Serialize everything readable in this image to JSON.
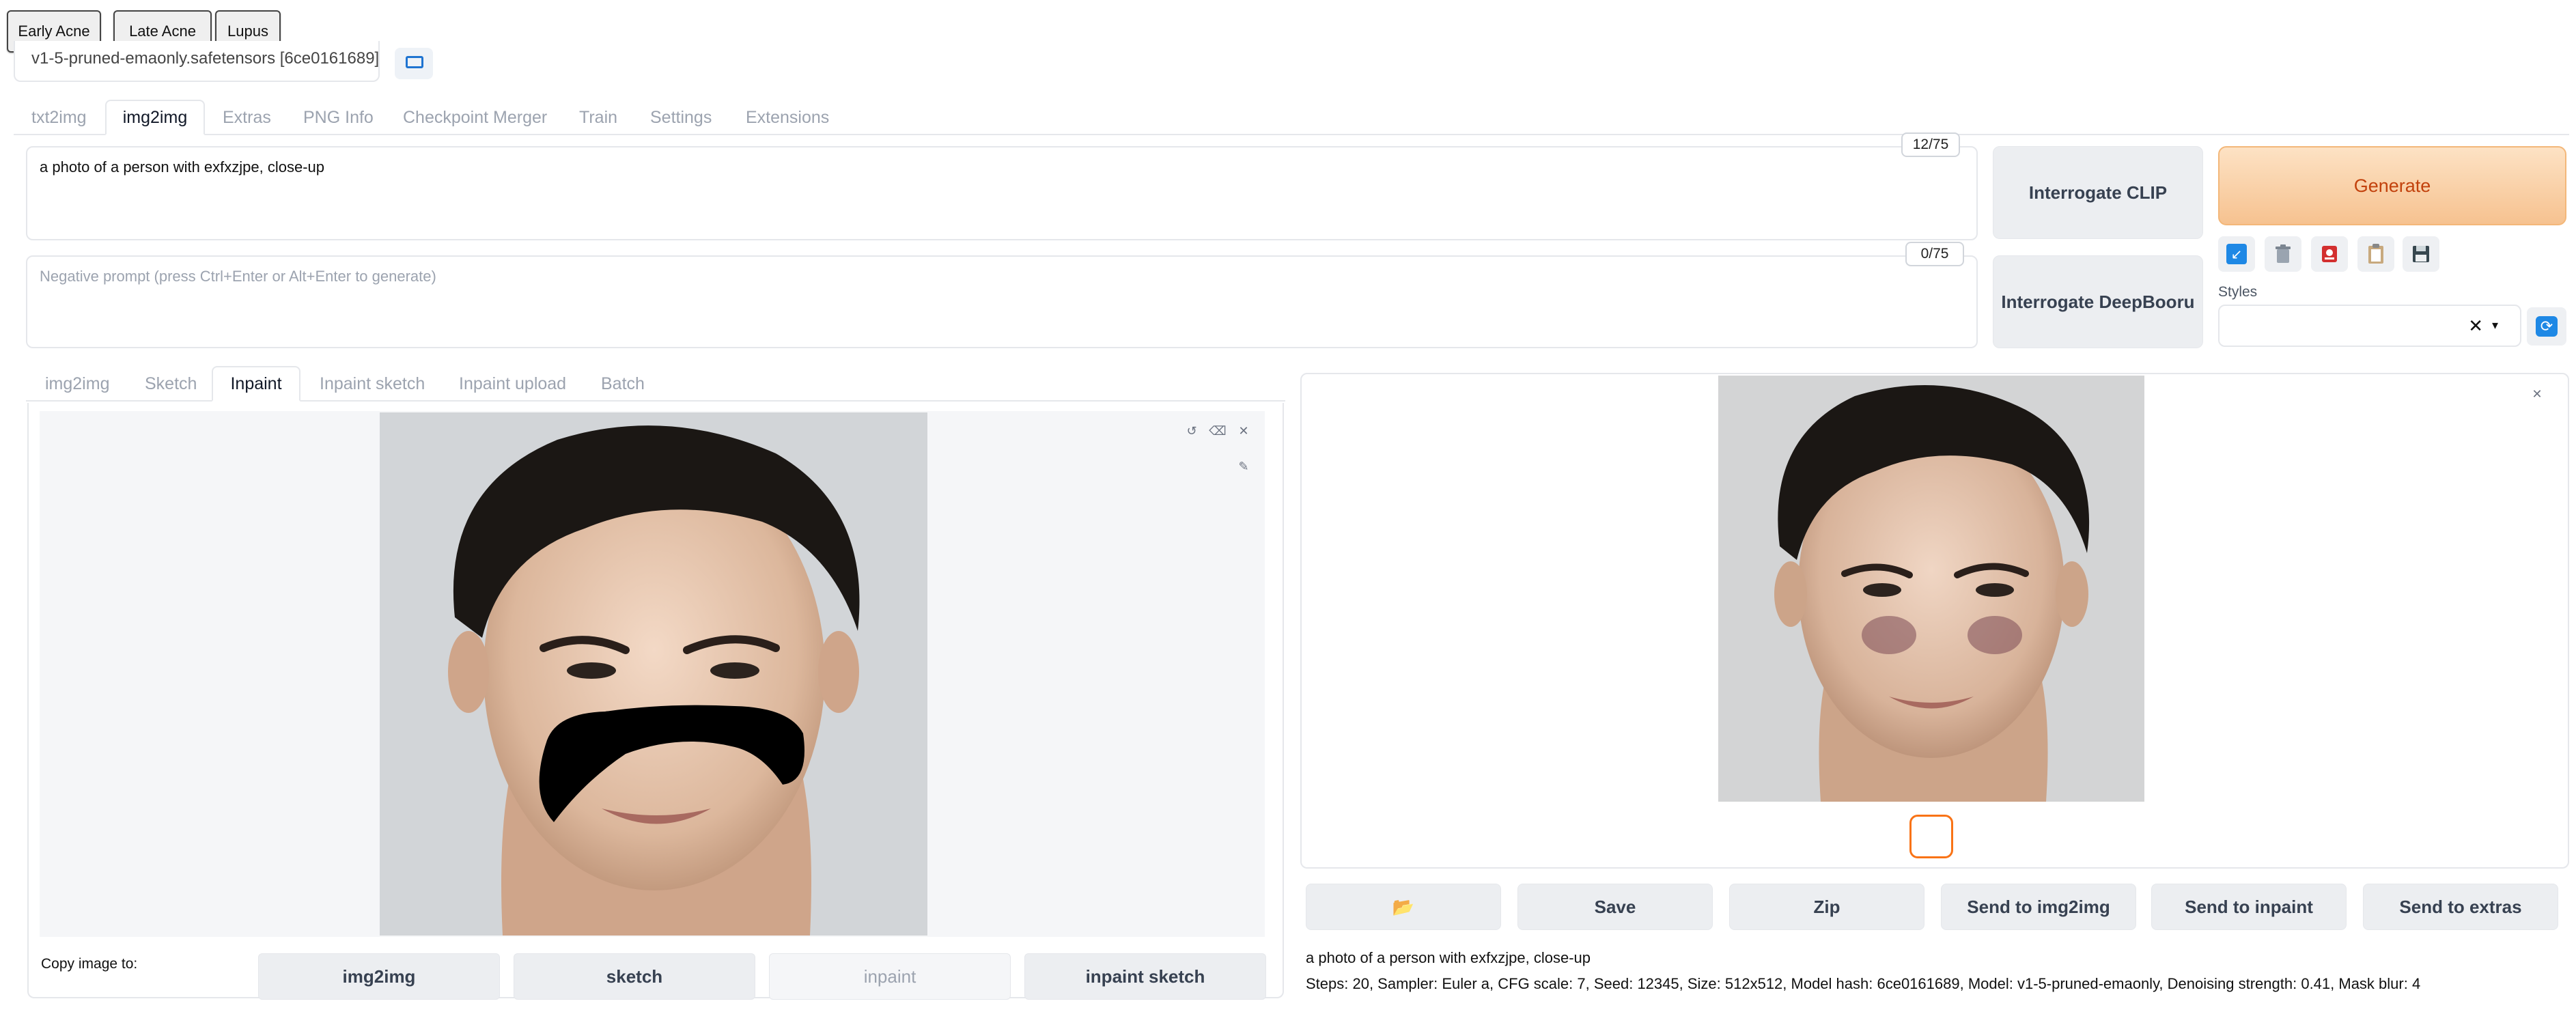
{
  "presets": [
    "Early Acne",
    "Late Acne",
    "Lupus"
  ],
  "checkpoint": {
    "value": "v1-5-pruned-emaonly.safetensors [6ce0161689]"
  },
  "main_tabs": [
    "txt2img",
    "img2img",
    "Extras",
    "PNG Info",
    "Checkpoint Merger",
    "Train",
    "Settings",
    "Extensions"
  ],
  "prompt": {
    "value": "a photo of a person with exfxzjpe, close-up",
    "counter": "12/75"
  },
  "negative_prompt": {
    "placeholder": "Negative prompt (press Ctrl+Enter or Alt+Enter to generate)",
    "counter": "0/75"
  },
  "interrogate": {
    "clip": "Interrogate CLIP",
    "deepbooru": "Interrogate DeepBooru"
  },
  "generate_label": "Generate",
  "tool_icons": [
    "arrow-icon",
    "trash-icon",
    "card-icon",
    "clipboard-icon",
    "save-icon"
  ],
  "styles": {
    "label": "Styles",
    "value": "",
    "clear": "✕",
    "caret": "▾"
  },
  "sub_tabs": [
    "img2img",
    "Sketch",
    "Inpaint",
    "Inpaint sketch",
    "Inpaint upload",
    "Batch"
  ],
  "canvas_controls": {
    "undo": "↺",
    "erase": "⌫",
    "close": "✕",
    "brush": "✎"
  },
  "copy_image": {
    "label": "Copy image to:",
    "targets": [
      "img2img",
      "sketch",
      "inpaint",
      "inpaint sketch"
    ]
  },
  "output": {
    "close": "✕",
    "buttons": [
      "📂",
      "Save",
      "Zip",
      "Send to img2img",
      "Send to inpaint",
      "Send to extras"
    ],
    "info_prompt": "a photo of a person with exfxzjpe, close-up",
    "info_params": "Steps: 20, Sampler: Euler a, CFG scale: 7, Seed: 12345, Size: 512x512, Model hash: 6ce0161689, Model: v1-5-pruned-emaonly, Denoising strength: 0.41, Mask blur: 4"
  },
  "colors": {
    "accent": "#f97316",
    "generate_text": "#c2410c",
    "link": "#1f74d1"
  }
}
